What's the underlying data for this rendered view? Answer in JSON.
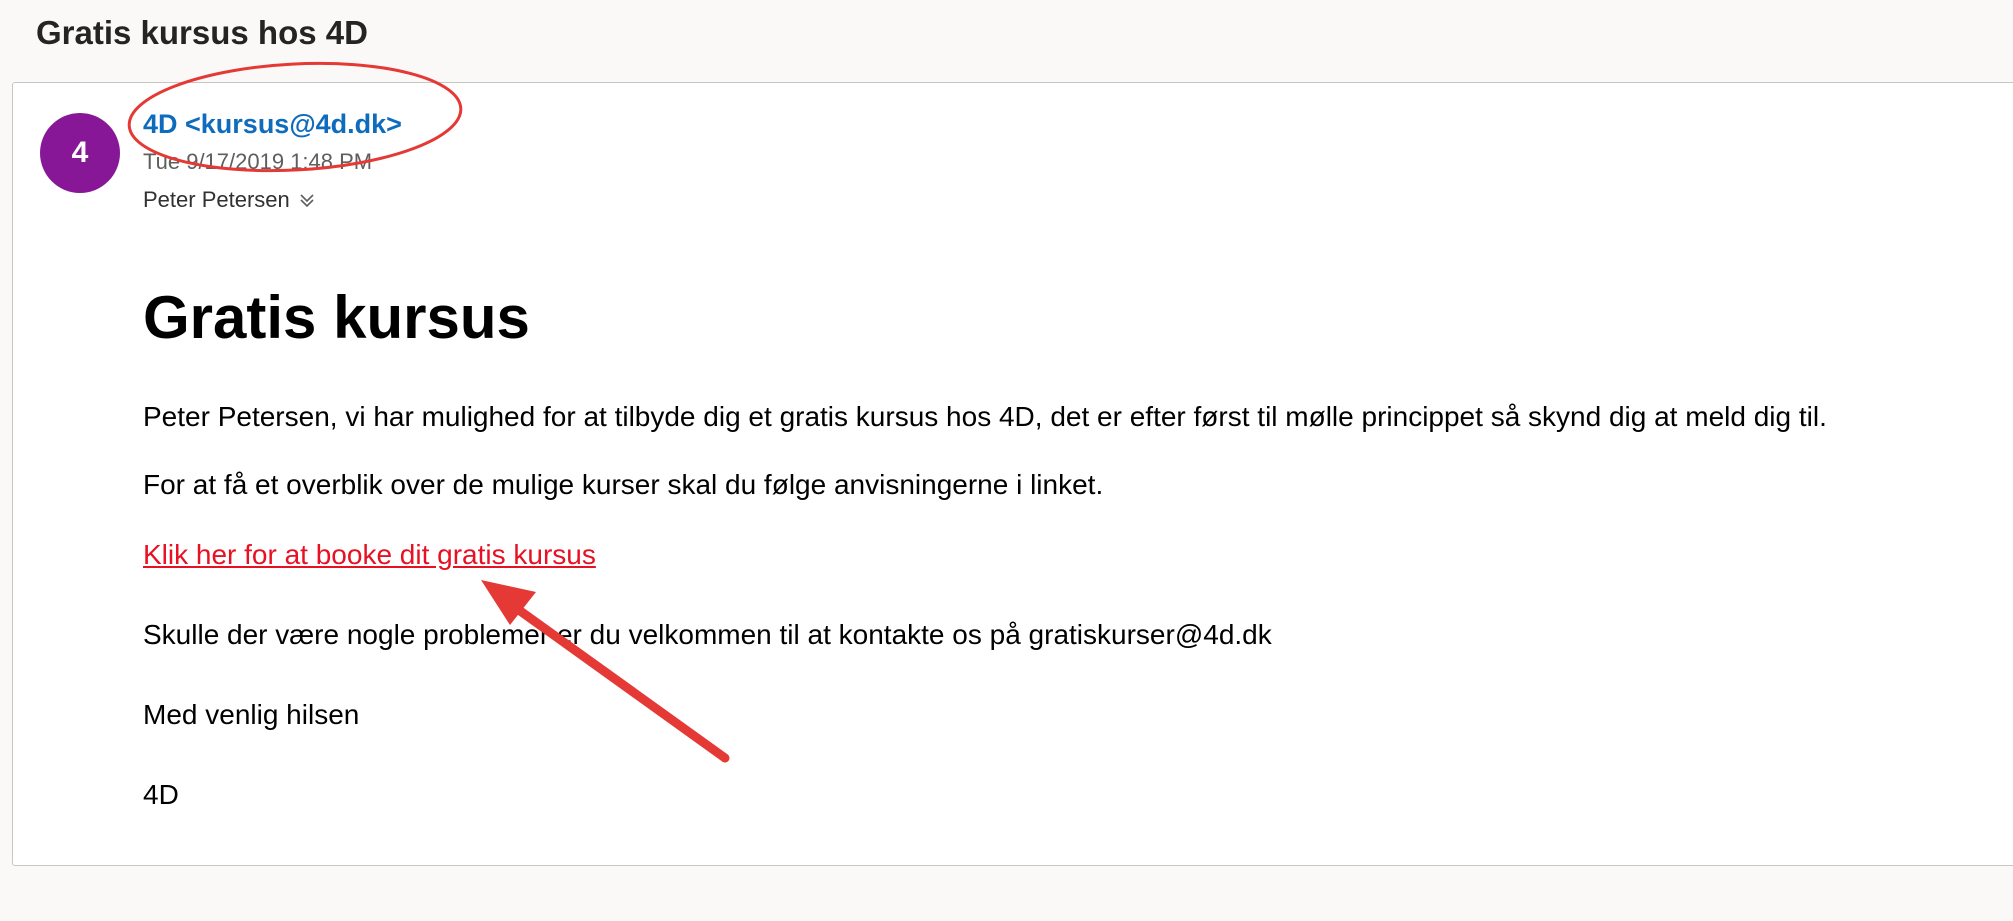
{
  "email": {
    "subject": "Gratis kursus hos 4D",
    "avatar_initial": "4",
    "sender": "4D <kursus@4d.dk>",
    "timestamp": "Tue 9/17/2019 1:48 PM",
    "recipient": "Peter Petersen",
    "body": {
      "headline": "Gratis kursus",
      "paragraph1": "Peter Petersen, vi har mulighed for at tilbyde dig et gratis kursus hos 4D, det er efter først til mølle princippet så skynd dig at meld dig til.",
      "paragraph2": "For at få et overblik over de mulige kurser skal du følge anvisningerne i linket.",
      "link_text": "Klik her for at booke dit gratis kursus",
      "paragraph3": "Skulle der være nogle problemer er du velkommen til at kontakte os på gratiskurser@4d.dk",
      "closing": "Med venlig hilsen",
      "signature": "4D"
    }
  },
  "colors": {
    "avatar_bg": "#881798",
    "sender_link": "#0f6cbd",
    "body_link": "#e81123",
    "annotation": "#e53935"
  },
  "icons": {
    "recipient_expand": "chevron-down-icon"
  }
}
